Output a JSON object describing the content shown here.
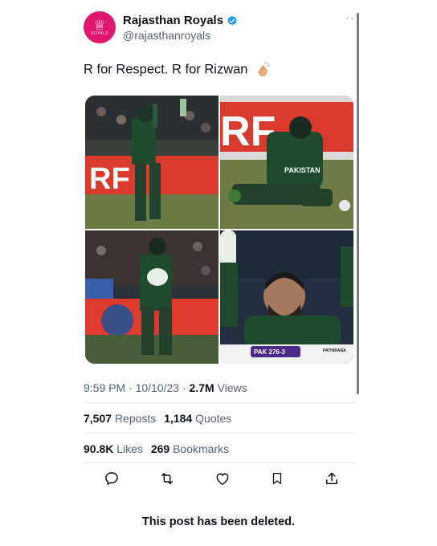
{
  "account": {
    "display_name": "Rajasthan Royals",
    "handle": "@rajasthanroyals",
    "avatar_text": "ROYALS",
    "verified": true,
    "more_label": "···"
  },
  "tweet": {
    "text": "R for Respect. R for Rizwan",
    "emoji_icon": "clapping-hands-icon"
  },
  "media": {
    "photos": [
      {
        "id": "top-left",
        "text": ""
      },
      {
        "id": "top-right",
        "text": "PAKISTAN"
      },
      {
        "id": "bottom-left",
        "text": ""
      },
      {
        "id": "bottom-right",
        "scoreboard": "PAK 276-3",
        "ticker": "PATHIRANA"
      }
    ]
  },
  "meta": {
    "time": "9:59 PM",
    "sep1": " · ",
    "date": "10/10/23",
    "sep2": " · ",
    "views_count": "2.7M",
    "views_label": "Views"
  },
  "stats": {
    "reposts_count": "7,507",
    "reposts_label": "Reposts",
    "quotes_count": "1,184",
    "quotes_label": "Quotes",
    "likes_count": "90.8K",
    "likes_label": "Likes",
    "bookmarks_count": "269",
    "bookmarks_label": "Bookmarks"
  },
  "actions": [
    "reply-icon",
    "repost-icon",
    "like-icon",
    "bookmark-icon",
    "share-icon"
  ],
  "colors": {
    "brand_pink": "#e1176e",
    "verified_blue": "#1d9bf0",
    "pak_green": "#1f4a2e"
  },
  "notice": "This post has been deleted."
}
